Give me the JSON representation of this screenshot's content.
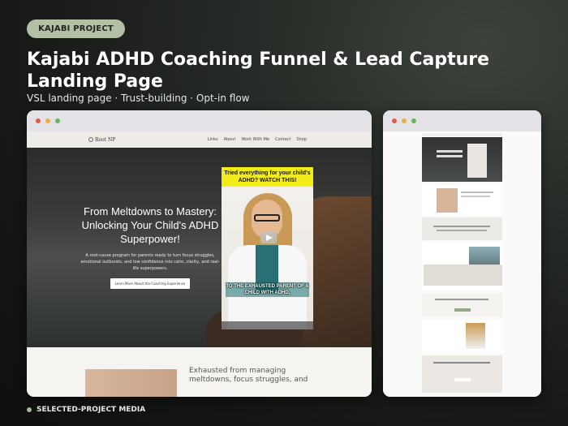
{
  "tag": "KAJABI PROJECT",
  "title": "Kajabi ADHD Coaching Funnel & Lead Capture Landing Page",
  "subtitle": "VSL landing page · Trust-building · Opt-in flow",
  "main_preview": {
    "logo": "Root NP",
    "nav": [
      "Links",
      "About",
      "Work With Me",
      "Contact",
      "Shop"
    ],
    "headline": "From Meltdowns to Mastery: Unlocking Your Child's ADHD Superpower!",
    "body": "A root-cause program for parents ready to turn focus struggles, emotional outbursts, and low confidence into calm, clarity, and real-life superpowers.",
    "cta": "Learn More About the Coaching Experience",
    "video_banner": "Tried everything for your child's ADHD? WATCH THIS!",
    "video_caption": "TO THE EXHAUSTED PARENT OF A CHILD WITH ADHD,",
    "below_text": "Exhausted from managing meltdowns, focus struggles, and"
  },
  "footer": "SELECTED-PROJECT MEDIA",
  "colors": {
    "accent": "#b2c0a6",
    "banner": "#f4ec19",
    "dot_red": "#e8564a",
    "dot_yellow": "#e8b23d",
    "dot_green": "#67b65b"
  }
}
